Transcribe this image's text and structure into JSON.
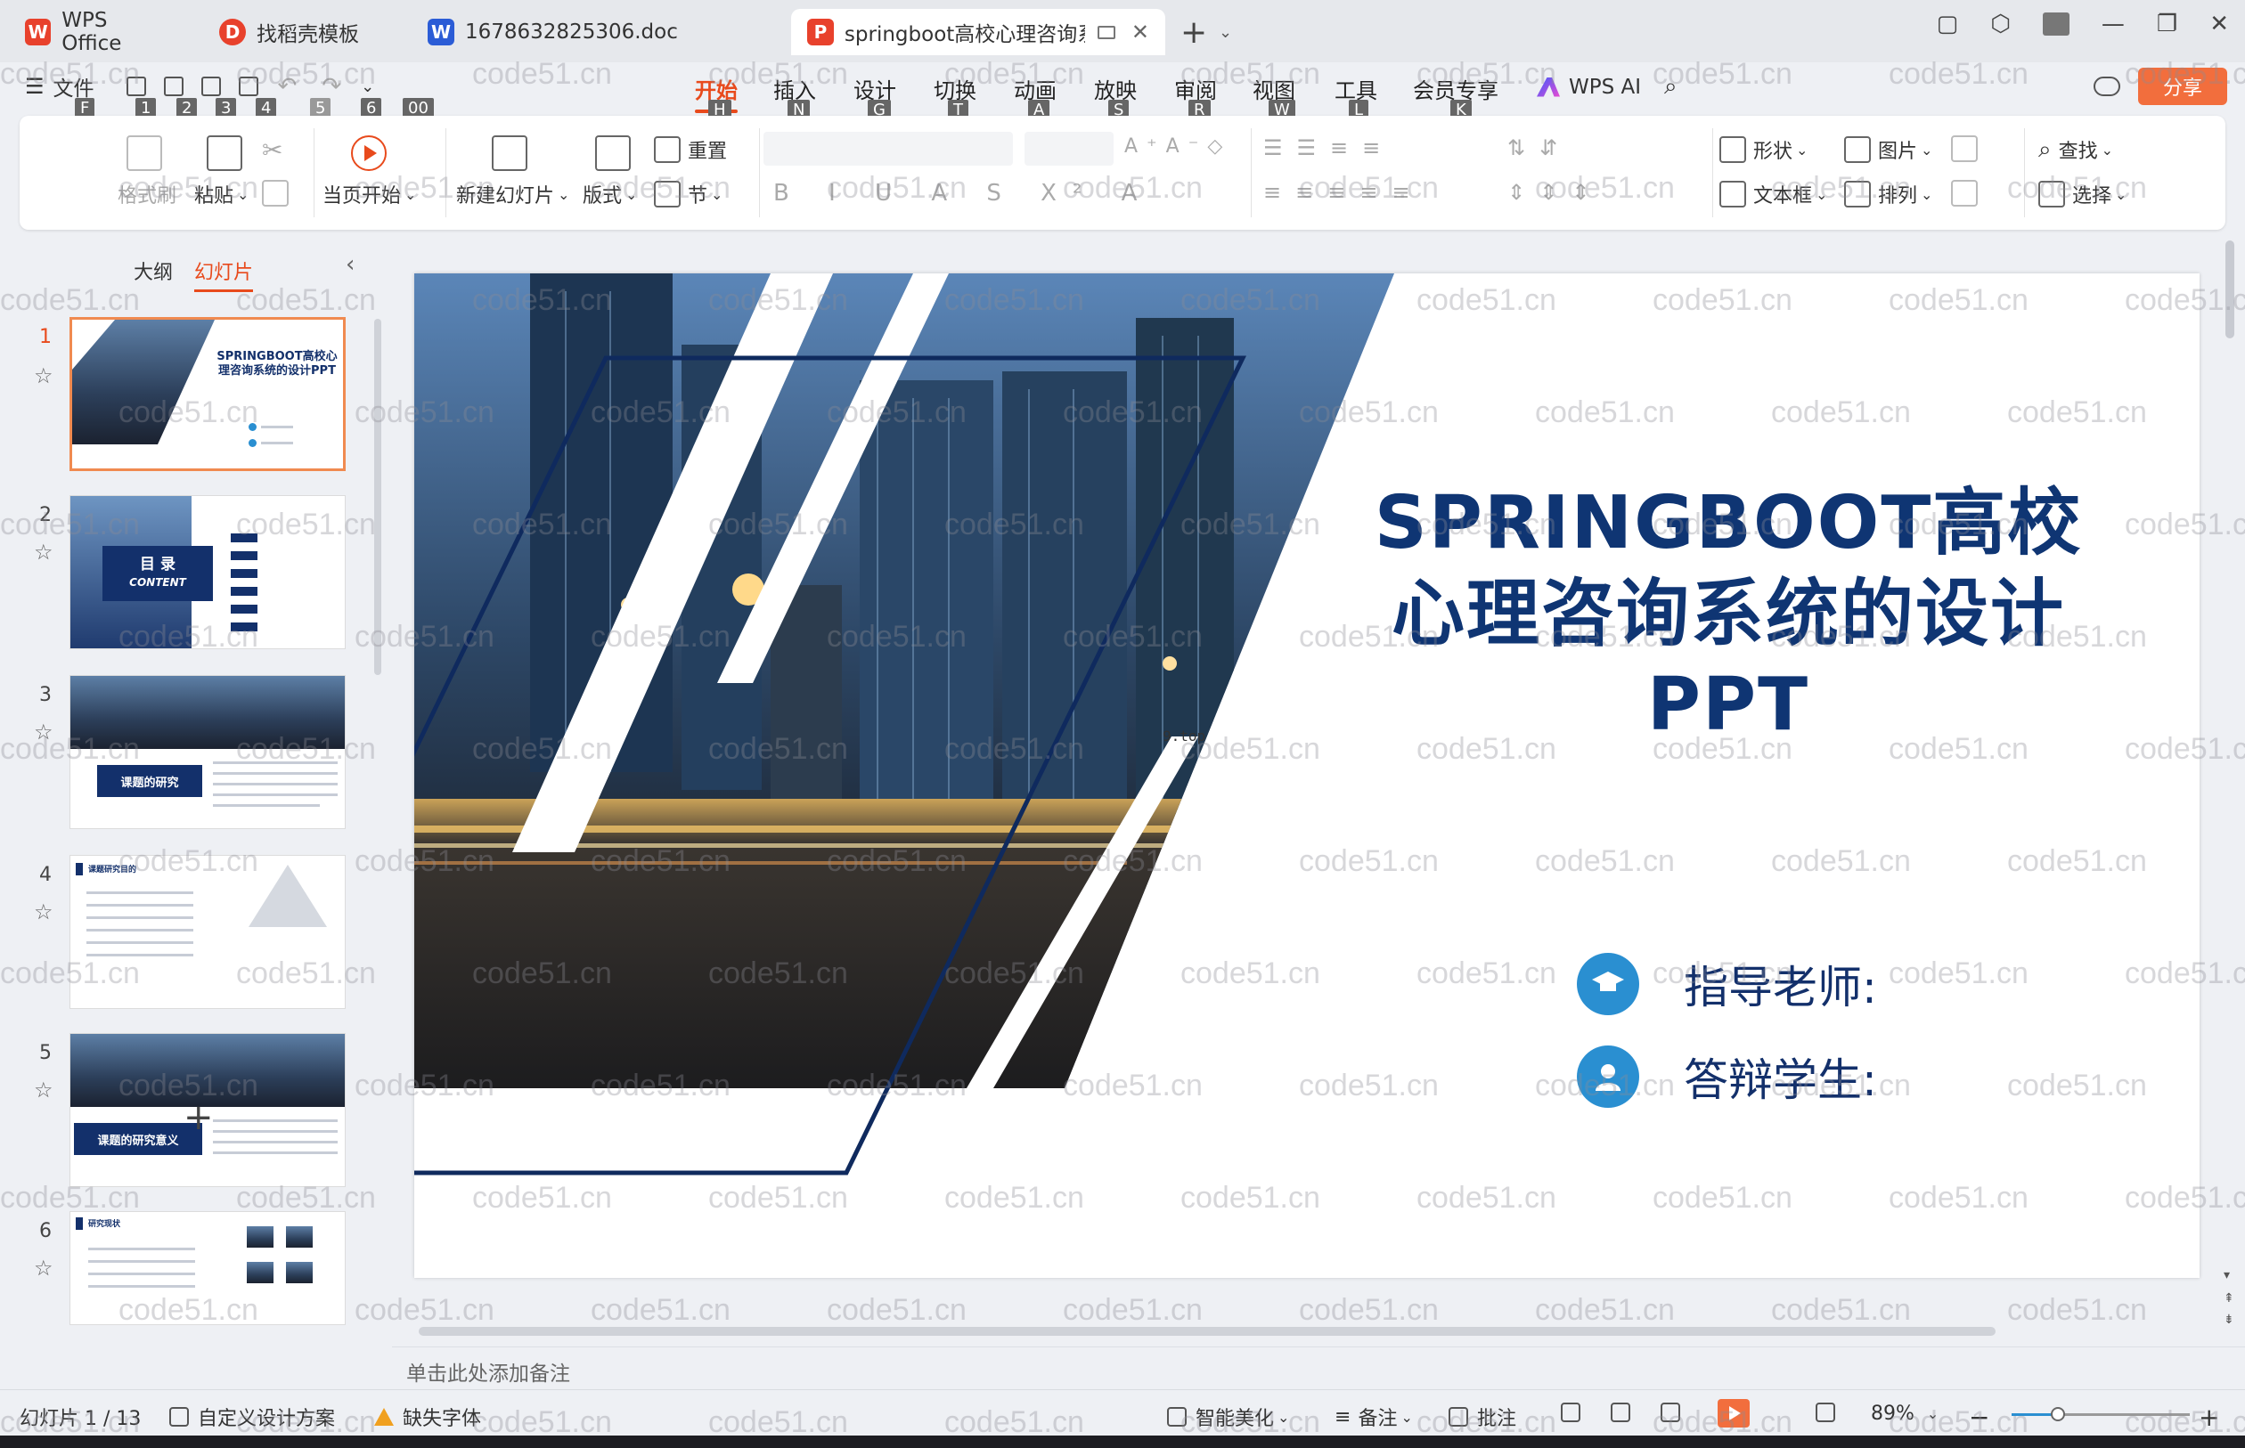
{
  "tabs": [
    {
      "label": "WPS Office",
      "logo": "W",
      "color": "#e8412c"
    },
    {
      "label": "找稻壳模板",
      "logo": "D",
      "color": "#e8412c"
    },
    {
      "label": "1678632825306.doc",
      "logo": "W",
      "color": "#2b5cd6"
    },
    {
      "label": "springboot高校心理咨询系统",
      "logo": "P",
      "color": "#e8412c"
    }
  ],
  "menu": {
    "file": "文件",
    "tabs": [
      "开始",
      "插入",
      "设计",
      "切换",
      "动画",
      "放映",
      "审阅",
      "视图",
      "工具",
      "会员专享"
    ],
    "active": "开始",
    "keytips": [
      "H",
      "N",
      "G",
      "T",
      "A",
      "S",
      "R",
      "W",
      "L",
      "K"
    ],
    "quick_keytips": [
      "F",
      "1",
      "2",
      "3",
      "4",
      "5",
      "6",
      "00"
    ],
    "wps_ai": "WPS AI",
    "share": "分享"
  },
  "ribbon": {
    "format_painter": "格式刷",
    "paste": "粘贴",
    "start_from_current": "当页开始",
    "new_slide": "新建幻灯片",
    "layout": "版式",
    "reset": "重置",
    "section": "节",
    "shape": "形状",
    "picture": "图片",
    "find": "查找",
    "textbox": "文本框",
    "arrange": "排列",
    "select": "选择"
  },
  "left_panel": {
    "tab_outline": "大纲",
    "tab_slides": "幻灯片",
    "thumbnails": [
      {
        "num": "1",
        "title": "SPRINGBOOT高校心理咨询系统的设计PPT"
      },
      {
        "num": "2",
        "title": "目 录",
        "subtitle": "CONTENT"
      },
      {
        "num": "3",
        "title": "课题的研究"
      },
      {
        "num": "4",
        "title": "课题研究目的"
      },
      {
        "num": "5",
        "title": "课题的研究意义"
      },
      {
        "num": "6",
        "title": "研究现状"
      }
    ]
  },
  "slide": {
    "title_line1": "SPRINGBOOT高校",
    "title_line2": "心理咨询系统的设计",
    "title_line3": "PPT",
    "teacher_label": "指导老师:",
    "student_label": "答辩学生:",
    "url_fragment": "9.top",
    "accent_navy": "#0f3573",
    "accent_blue": "#2a8fd1"
  },
  "notes_placeholder": "单击此处添加备注",
  "status": {
    "slide_counter": "幻灯片 1 / 13",
    "custom_design": "自定义设计方案",
    "missing_font": "缺失字体",
    "smart_beautify": "智能美化",
    "notes": "备注",
    "comments": "批注",
    "zoom": "89%",
    "zoom_fraction": 0.26
  },
  "watermark": "code51.cn"
}
